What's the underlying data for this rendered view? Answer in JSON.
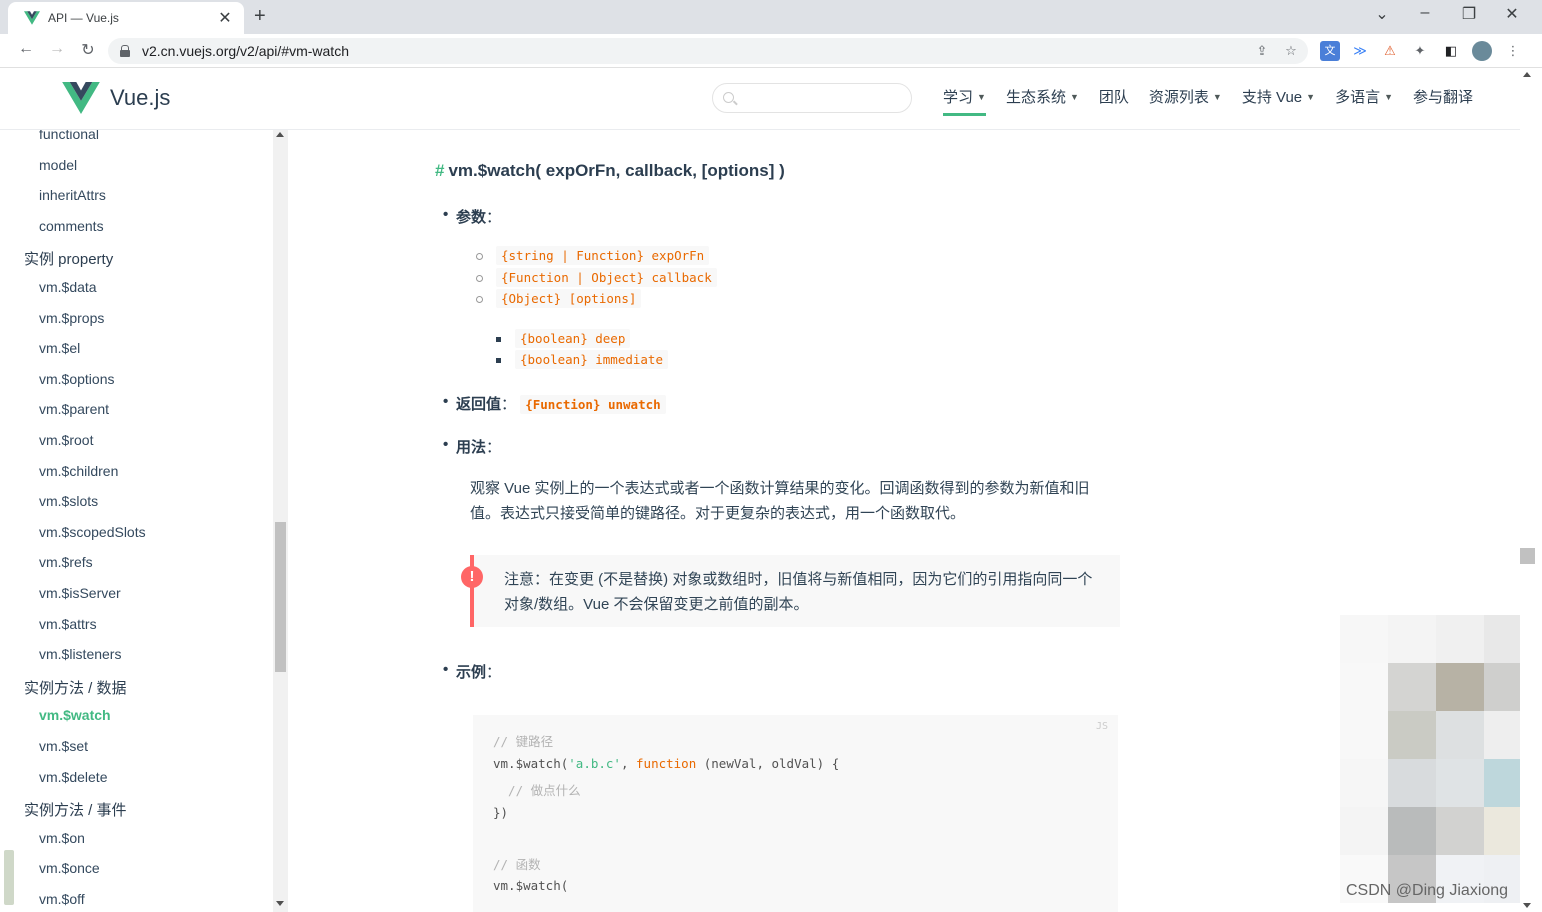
{
  "browser": {
    "tab_title": "API — Vue.js",
    "url": "v2.cn.vuejs.org/v2/api/#vm-watch",
    "new_tab": "+",
    "tab_close": "✕"
  },
  "header": {
    "brand": "Vue.js",
    "search_placeholder": "",
    "nav": [
      {
        "label": "学习",
        "dropdown": true
      },
      {
        "label": "生态系统",
        "dropdown": true
      },
      {
        "label": "团队",
        "dropdown": false
      },
      {
        "label": "资源列表",
        "dropdown": true
      },
      {
        "label": "支持 Vue",
        "dropdown": true
      },
      {
        "label": "多语言",
        "dropdown": true
      },
      {
        "label": "参与翻译",
        "dropdown": false
      }
    ]
  },
  "sidebar": {
    "items": [
      {
        "label": "functional",
        "type": "item"
      },
      {
        "label": "model",
        "type": "item"
      },
      {
        "label": "inheritAttrs",
        "type": "item"
      },
      {
        "label": "comments",
        "type": "item"
      },
      {
        "label": "实例 property",
        "type": "section"
      },
      {
        "label": "vm.$data",
        "type": "item"
      },
      {
        "label": "vm.$props",
        "type": "item"
      },
      {
        "label": "vm.$el",
        "type": "item"
      },
      {
        "label": "vm.$options",
        "type": "item"
      },
      {
        "label": "vm.$parent",
        "type": "item"
      },
      {
        "label": "vm.$root",
        "type": "item"
      },
      {
        "label": "vm.$children",
        "type": "item"
      },
      {
        "label": "vm.$slots",
        "type": "item"
      },
      {
        "label": "vm.$scopedSlots",
        "type": "item"
      },
      {
        "label": "vm.$refs",
        "type": "item"
      },
      {
        "label": "vm.$isServer",
        "type": "item"
      },
      {
        "label": "vm.$attrs",
        "type": "item"
      },
      {
        "label": "vm.$listeners",
        "type": "item"
      },
      {
        "label": "实例方法 / 数据",
        "type": "section"
      },
      {
        "label": "vm.$watch",
        "type": "item",
        "active": true
      },
      {
        "label": "vm.$set",
        "type": "item"
      },
      {
        "label": "vm.$delete",
        "type": "item"
      },
      {
        "label": "实例方法 / 事件",
        "type": "section"
      },
      {
        "label": "vm.$on",
        "type": "item"
      },
      {
        "label": "vm.$once",
        "type": "item"
      },
      {
        "label": "vm.$off",
        "type": "item"
      }
    ]
  },
  "content": {
    "hash": "#",
    "heading": "vm.$watch( expOrFn, callback, [options] )",
    "params_label": "参数",
    "params": [
      "{string | Function} expOrFn",
      "{Function | Object} callback",
      "{Object} [options]"
    ],
    "options": [
      "{boolean} deep",
      "{boolean} immediate"
    ],
    "returns_label": "返回值",
    "returns": "{Function} unwatch",
    "usage_label": "用法",
    "usage_text": "观察 Vue 实例上的一个表达式或者一个函数计算结果的变化。回调函数得到的参数为新值和旧值。表达式只接受简单的键路径。对于更复杂的表达式，用一个函数取代。",
    "warning": "注意：在变更 (不是替换) 对象或数组时，旧值将与新值相同，因为它们的引用指向同一个对象/数组。Vue 不会保留变更之前值的副本。",
    "warning_icon": "!",
    "example_label": "示例",
    "code_lang": "JS",
    "code": {
      "c1": "// 键路径",
      "l2a": "vm.$watch(",
      "l2s": "'a.b.c'",
      "l2b": ", ",
      "l2k": "function",
      "l2c": " (newVal, oldVal) {",
      "c3": "  // 做点什么",
      "l4": "})",
      "c6": "// 函数",
      "l7": "vm.$watch("
    }
  },
  "colon": "：",
  "watermark": "CSDN @Ding Jiaxiong"
}
